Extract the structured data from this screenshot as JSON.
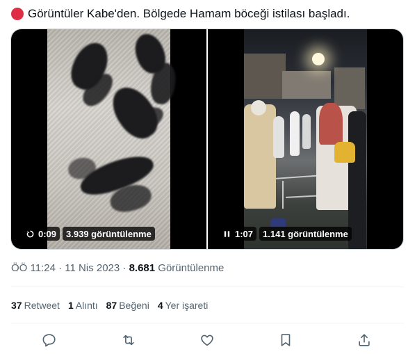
{
  "tweet": {
    "text": "Görüntüler Kabe'den. Bölgede  Hamam böceği istilası başladı.",
    "emoji_icon": "red-circle-icon"
  },
  "media": {
    "videos": [
      {
        "state_icon": "replay-icon",
        "time": "0:09",
        "views": "3.939 görüntülenme"
      },
      {
        "state_icon": "pause-icon",
        "time": "1:07",
        "views": "1.141 görüntülenme"
      }
    ]
  },
  "meta": {
    "time": "ÖÖ 11:24",
    "separator1": " · ",
    "date": "11 Nis 2023",
    "separator2": " · ",
    "views_count": "8.681",
    "views_label": " Görüntülenme"
  },
  "stats": [
    {
      "count": "37",
      "label": "Retweet"
    },
    {
      "count": "1",
      "label": "Alıntı"
    },
    {
      "count": "87",
      "label": "Beğeni"
    },
    {
      "count": "4",
      "label": "Yer işareti"
    }
  ],
  "actions": [
    "reply-icon",
    "retweet-icon",
    "like-icon",
    "bookmark-icon",
    "share-icon"
  ],
  "colors": {
    "text": "#0f1419",
    "secondary": "#536471",
    "divider": "#eff3f4",
    "red_dot": "#dd2e44"
  }
}
